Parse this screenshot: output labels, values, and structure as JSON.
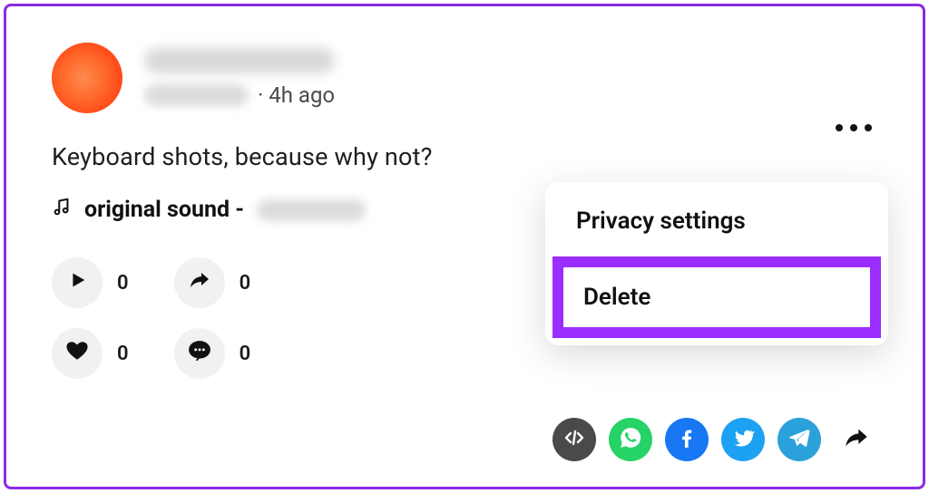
{
  "post": {
    "timestamp": "· 4h ago",
    "caption": "Keyboard shots, because why not?",
    "sound_label": "original sound -"
  },
  "stats": {
    "plays": "0",
    "shares": "0",
    "likes": "0",
    "comments": "0"
  },
  "menu": {
    "privacy": "Privacy settings",
    "delete": "Delete"
  }
}
